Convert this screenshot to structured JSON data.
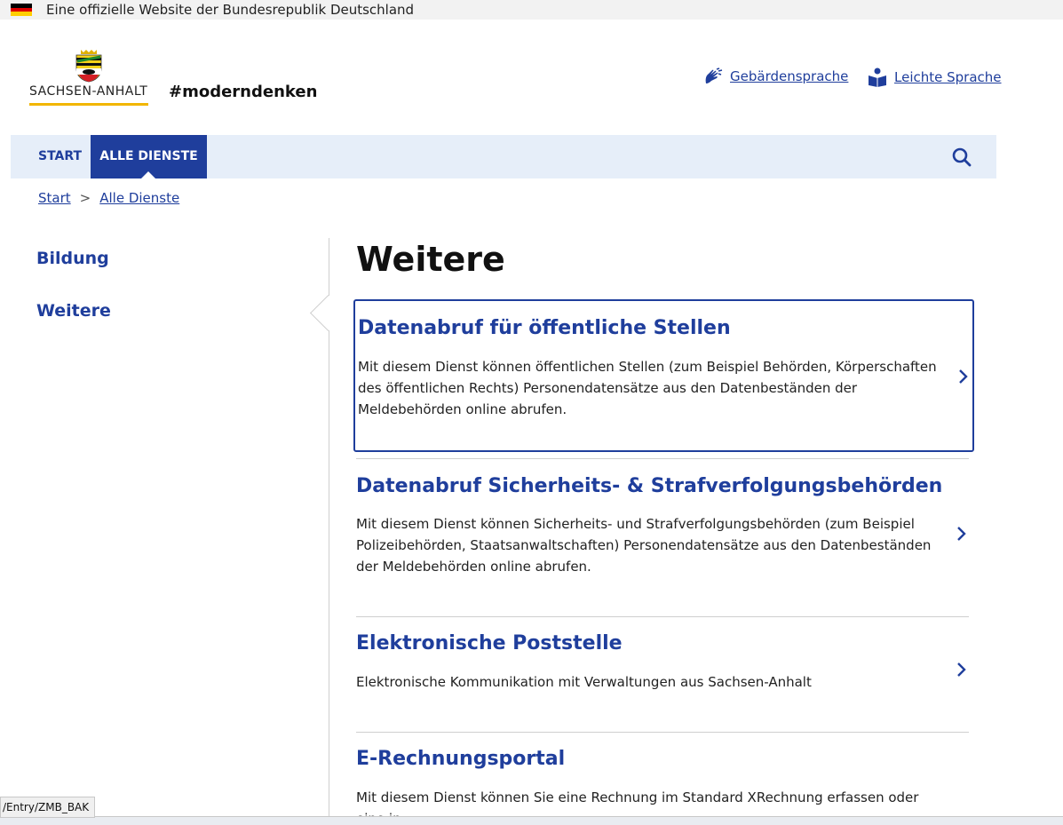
{
  "topbar": {
    "text": "Eine offizielle Website der Bundesrepublik Deutschland"
  },
  "logo": {
    "text": "SACHSEN-ANHALT"
  },
  "hashtag": "#moderndenken",
  "header_links": {
    "sign_language": "Gebärdensprache",
    "easy_language": "Leichte Sprache"
  },
  "nav": {
    "start": "START",
    "all_services": "ALLE DIENSTE"
  },
  "breadcrumb": {
    "start": "Start",
    "separator": ">",
    "current": "Alle Dienste"
  },
  "sidebar": {
    "items": [
      {
        "label": "Bildung"
      },
      {
        "label": "Weitere"
      }
    ]
  },
  "main": {
    "title": "Weitere",
    "cards": [
      {
        "title": "Datenabruf für öffentliche Stellen",
        "desc": "Mit diesem Dienst können öffentlichen Stellen (zum Beispiel Behörden, Körperschaften des öffentlichen Rechts) Personendatensätze aus den Datenbeständen der Meldebehörden online abrufen."
      },
      {
        "title": "Datenabruf Sicherheits- & Strafverfolgungsbehörden",
        "desc": "Mit diesem Dienst können Sicherheits- und Strafverfolgungsbehörden (zum Beispiel Polizeibehörden, Staatsanwaltschaften) Personendatensätze aus den Datenbeständen der Meldebehörden online abrufen."
      },
      {
        "title": "Elektronische Poststelle",
        "desc": "Elektronische Kommunikation mit Verwaltungen aus Sachsen-Anhalt"
      },
      {
        "title": "E-Rechnungsportal",
        "desc": "Mit diesem Dienst können Sie eine Rechnung im Standard XRechnung erfassen oder eine in"
      }
    ]
  },
  "statusbar": {
    "text": "/Entry/ZMB_BAK"
  },
  "colors": {
    "brand_blue": "#1f3e9c",
    "nav_bg": "#e6eef9",
    "accent_yellow": "#f2b600"
  },
  "icons": [
    "flag-de-icon",
    "coat-of-arms-icon",
    "sign-language-icon",
    "easy-language-icon",
    "search-icon",
    "chevron-right-icon"
  ]
}
